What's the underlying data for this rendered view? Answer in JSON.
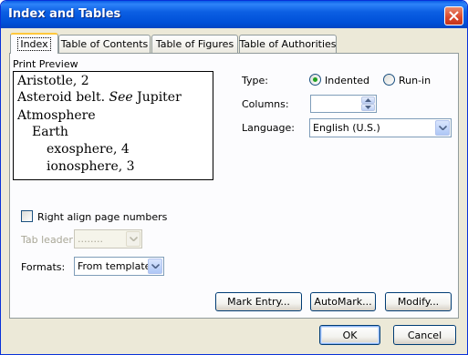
{
  "window": {
    "title": "Index and Tables"
  },
  "tabs": [
    {
      "label": "Index",
      "active": true
    },
    {
      "label": "Table of Contents",
      "active": false
    },
    {
      "label": "Table of Figures",
      "active": false
    },
    {
      "label": "Table of Authorities",
      "active": false
    }
  ],
  "preview": {
    "label": "Print Preview",
    "line1": "Aristotle, 2",
    "line2_prefix": "Asteroid belt.",
    "line2_see": "See",
    "line2_suffix": "Jupiter",
    "line3": "Atmosphere",
    "line4": "Earth",
    "line5": "exosphere, 4",
    "line6": "ionosphere, 3"
  },
  "type": {
    "label": "Type:",
    "option_indented": "Indented",
    "option_runin": "Run-in",
    "selected": "Indented"
  },
  "columns": {
    "label": "Columns:",
    "value": ""
  },
  "language": {
    "label": "Language:",
    "value": "English (U.S.)"
  },
  "right_align": {
    "label": "Right align page numbers",
    "checked": false
  },
  "tab_leader": {
    "label": "Tab leader:",
    "value": "........"
  },
  "formats": {
    "label": "Formats:",
    "value": "From template"
  },
  "buttons": {
    "mark_entry": "Mark Entry...",
    "automark": "AutoMark...",
    "modify": "Modify...",
    "ok": "OK",
    "cancel": "Cancel"
  },
  "colors": {
    "titlebar": "#0054e3",
    "dialog_bg": "#ece9d8",
    "radio_dot": "#21a121"
  }
}
